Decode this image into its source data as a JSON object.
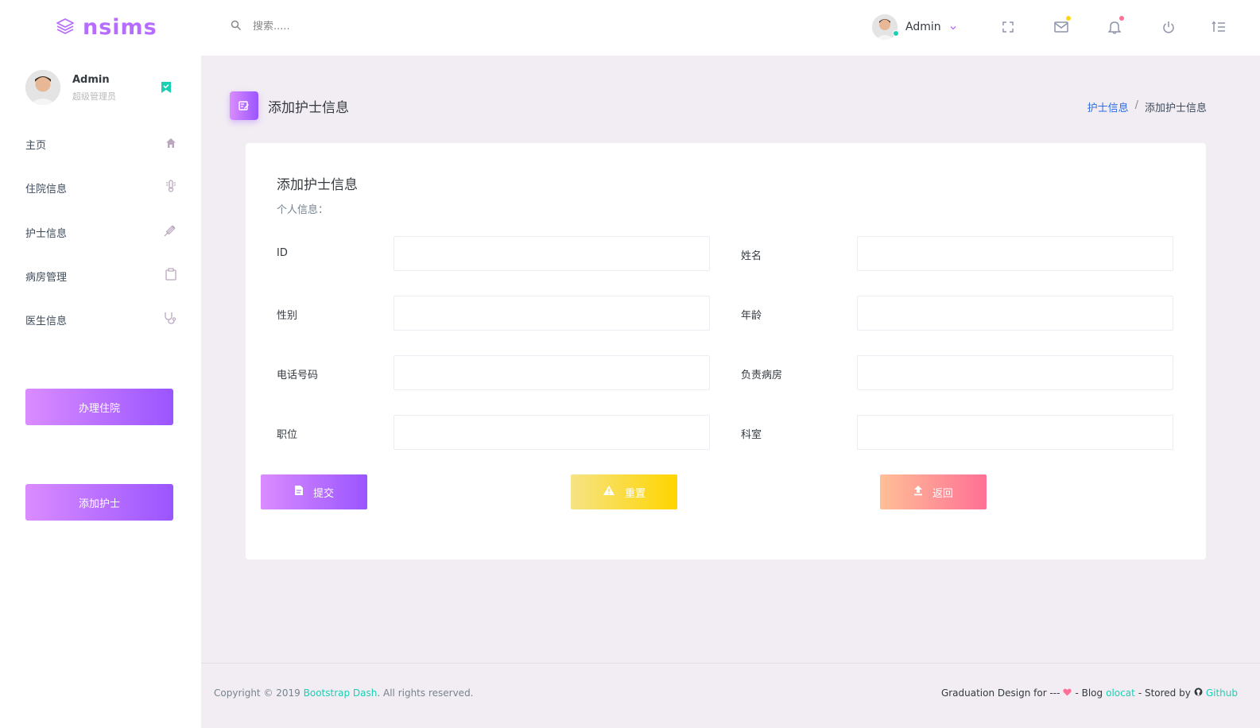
{
  "brand": {
    "name": "nsims"
  },
  "search": {
    "placeholder": "搜索....."
  },
  "navbar": {
    "user_name": "Admin",
    "colors": {
      "mail_dot": "#fed713",
      "bell_dot": "#fe7096",
      "online": "#1bcfb4"
    }
  },
  "sidebar": {
    "profile": {
      "name": "Admin",
      "role": "超级管理员"
    },
    "items": [
      {
        "label": "主页",
        "icon": "home-icon"
      },
      {
        "label": "住院信息",
        "icon": "thermometer-icon"
      },
      {
        "label": "护士信息",
        "icon": "syringe-icon"
      },
      {
        "label": "病房管理",
        "icon": "clipboard-icon"
      },
      {
        "label": "医生信息",
        "icon": "stethoscope-icon"
      }
    ],
    "buttons": {
      "admit": "办理住院",
      "add_nurse": "添加护士"
    }
  },
  "page": {
    "title": "添加护士信息",
    "breadcrumb": {
      "parent": "护士信息",
      "sep": "/",
      "current": "添加护士信息"
    }
  },
  "form": {
    "title": "添加护士信息",
    "subtitle": "个人信息：",
    "fields": {
      "id": {
        "label": "ID",
        "value": ""
      },
      "name": {
        "label": "姓名",
        "value": ""
      },
      "gender": {
        "label": "性别",
        "value": ""
      },
      "age": {
        "label": "年龄",
        "value": ""
      },
      "phone": {
        "label": "电话号码",
        "value": ""
      },
      "ward": {
        "label": "负责病房",
        "value": ""
      },
      "position": {
        "label": "职位",
        "value": ""
      },
      "department": {
        "label": "科室",
        "value": ""
      }
    },
    "buttons": {
      "submit": "提交",
      "reset": "重置",
      "back": "返回"
    }
  },
  "footer": {
    "copyright_prefix": "Copyright © 2019 ",
    "copyright_link": "Bootstrap Dash",
    "copyright_suffix": ". All rights reserved.",
    "design_text": "Graduation Design for ---",
    "blog_prefix": "- Blog",
    "blog_link": "olocat",
    "stored_prefix": "- Stored by",
    "stored_link": "Github"
  },
  "colors": {
    "accent": "#b66dff",
    "teal": "#1bcfb4",
    "link_blue": "#2f6de0",
    "background": "#f2edf3"
  }
}
